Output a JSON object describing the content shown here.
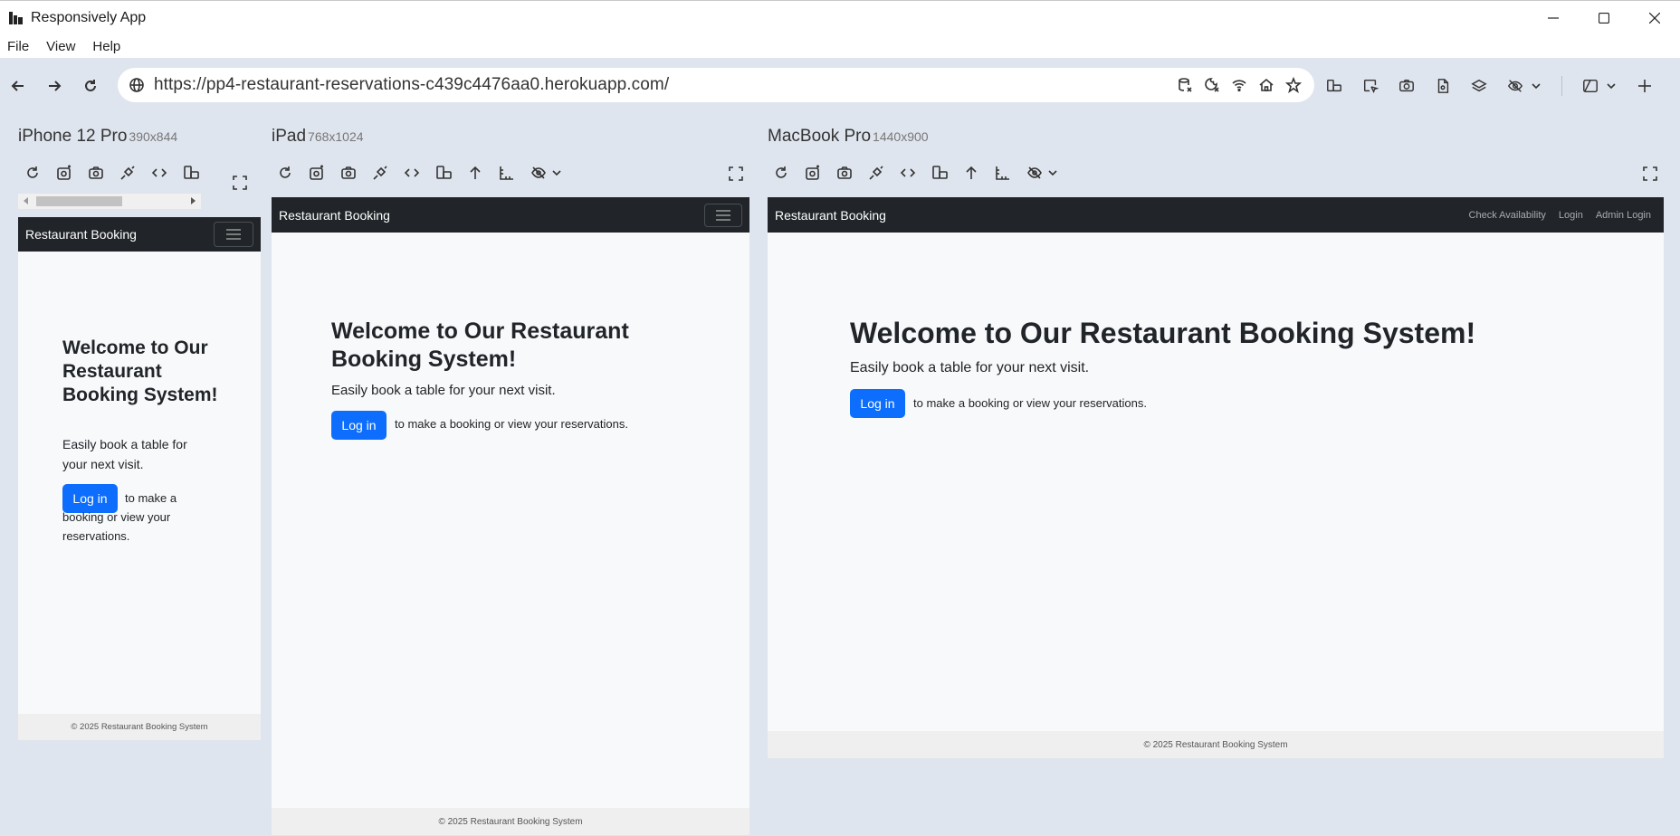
{
  "app": {
    "title": "Responsively App",
    "menu": [
      "File",
      "View",
      "Help"
    ]
  },
  "address_bar": {
    "url": "https://pp4-restaurant-reservations-c439c4476aa0.herokuapp.com/"
  },
  "icons": {
    "back": "arrow-left-icon",
    "forward": "arrow-right-icon",
    "reload": "reload-icon",
    "globe": "globe-icon",
    "address_bar_icons": [
      "database-clear-icon",
      "cookie-clear-icon",
      "network-icon",
      "home-icon",
      "star-icon"
    ],
    "toolbar_icons": [
      "rotate-devices-icon",
      "inspect-icon",
      "screenshot-icon",
      "capture-all-icon",
      "layers-icon",
      "hide-icon",
      "dropdown-icon",
      "preview-layout-icon",
      "new-tab-icon"
    ]
  },
  "devices": [
    {
      "name": "iPhone 12 Pro",
      "dims": "390x844"
    },
    {
      "name": "iPad",
      "dims": "768x1024"
    },
    {
      "name": "MacBook Pro",
      "dims": "1440x900"
    }
  ],
  "site": {
    "brand": "Restaurant Booking",
    "nav_links": [
      "Check Availability",
      "Login",
      "Admin Login"
    ],
    "heading": "Welcome to Our Restaurant Booking System!",
    "subtitle": "Easily book a table for your next visit.",
    "login_button": "Log in",
    "after_button": "to make a booking or view your reservations.",
    "footer": "© 2025 Restaurant Booking System"
  },
  "colors": {
    "navbar": "#212529",
    "primary_button": "#0d6efd",
    "page_bg": "#f8f9fa",
    "app_bg": "#dfe5ee"
  }
}
